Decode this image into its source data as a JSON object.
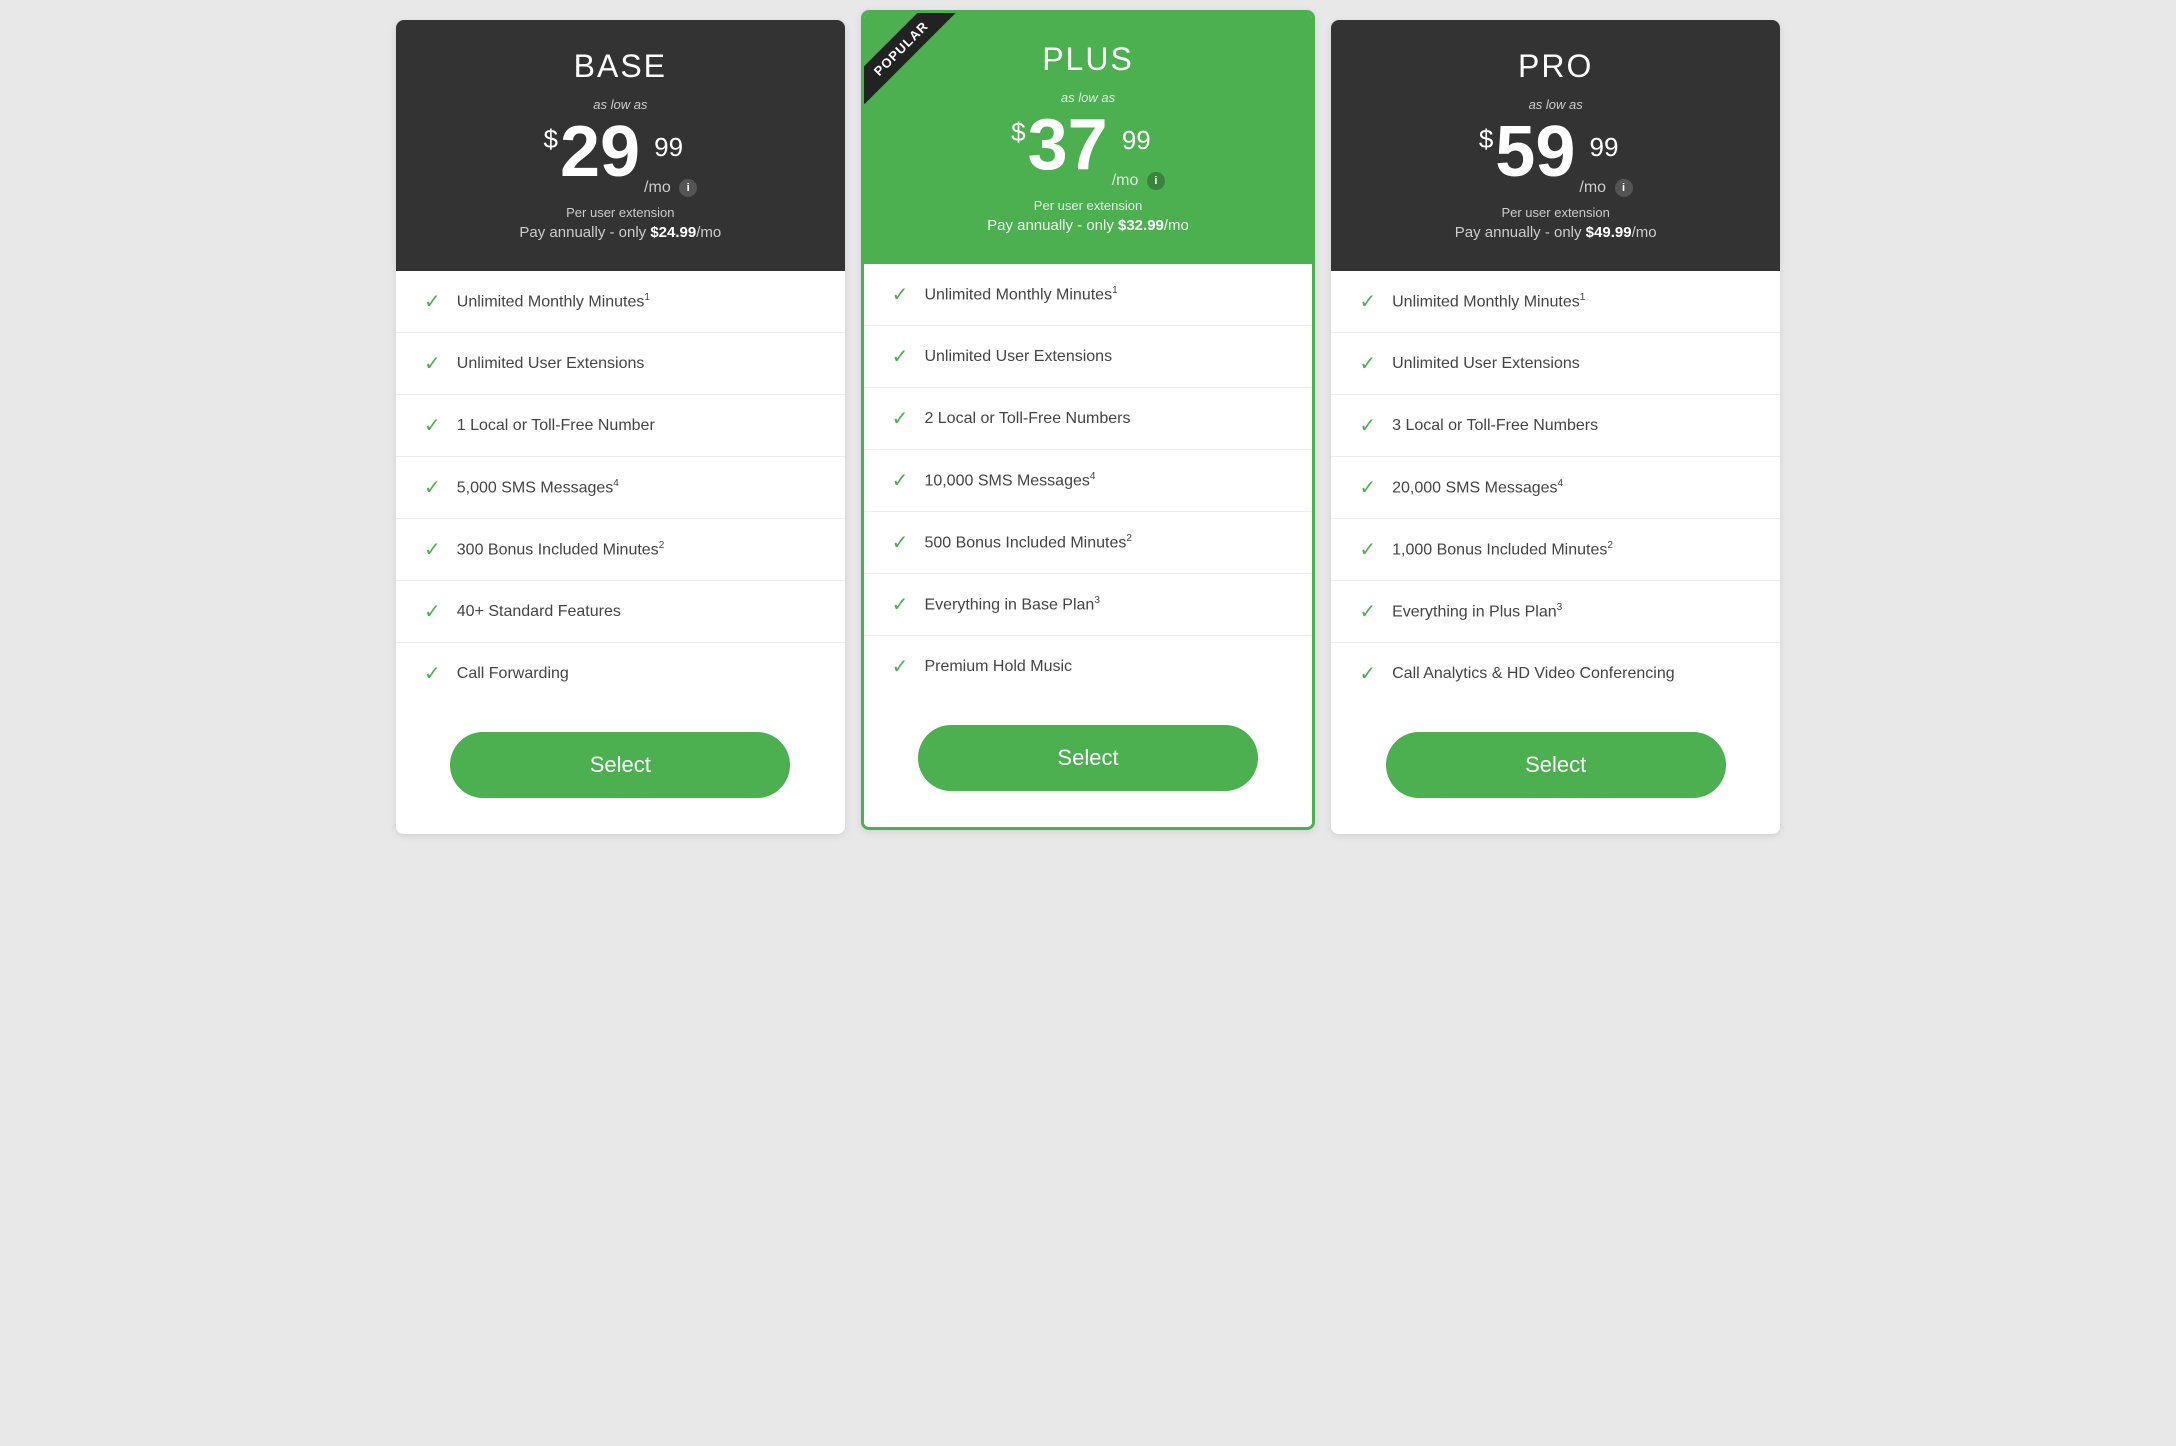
{
  "plans": [
    {
      "id": "base",
      "name": "BASE",
      "popular": false,
      "header_bg": "dark",
      "as_low_as": "as low as",
      "currency": "$",
      "price_main": "29",
      "price_decimal": "99",
      "per_mo": "/mo",
      "per_user": "Per user extension",
      "pay_annually": "Pay annually - only ",
      "annual_price": "$24.99",
      "annual_suffix": "/mo",
      "features": [
        {
          "text": "Unlimited Monthly Minutes",
          "sup": "1"
        },
        {
          "text": "Unlimited User Extensions",
          "sup": ""
        },
        {
          "text": "1 Local or Toll-Free Number",
          "sup": ""
        },
        {
          "text": "5,000 SMS Messages",
          "sup": "4"
        },
        {
          "text": "300 Bonus Included Minutes",
          "sup": "2"
        },
        {
          "text": "40+ Standard Features",
          "sup": ""
        },
        {
          "text": "Call Forwarding",
          "sup": ""
        }
      ],
      "select_label": "Select"
    },
    {
      "id": "plus",
      "name": "PLUS",
      "popular": true,
      "popular_label": "POPULAR",
      "header_bg": "green",
      "as_low_as": "as low as",
      "currency": "$",
      "price_main": "37",
      "price_decimal": "99",
      "per_mo": "/mo",
      "per_user": "Per user extension",
      "pay_annually": "Pay annually - only ",
      "annual_price": "$32.99",
      "annual_suffix": "/mo",
      "features": [
        {
          "text": "Unlimited Monthly Minutes",
          "sup": "1"
        },
        {
          "text": "Unlimited User Extensions",
          "sup": ""
        },
        {
          "text": "2 Local or Toll-Free Numbers",
          "sup": ""
        },
        {
          "text": "10,000 SMS Messages",
          "sup": "4"
        },
        {
          "text": "500 Bonus Included Minutes",
          "sup": "2"
        },
        {
          "text": "Everything in Base Plan",
          "sup": "3"
        },
        {
          "text": "Premium Hold Music",
          "sup": ""
        }
      ],
      "select_label": "Select"
    },
    {
      "id": "pro",
      "name": "PRO",
      "popular": false,
      "header_bg": "dark",
      "as_low_as": "as low as",
      "currency": "$",
      "price_main": "59",
      "price_decimal": "99",
      "per_mo": "/mo",
      "per_user": "Per user extension",
      "pay_annually": "Pay annually - only ",
      "annual_price": "$49.99",
      "annual_suffix": "/mo",
      "features": [
        {
          "text": "Unlimited Monthly Minutes",
          "sup": "1"
        },
        {
          "text": "Unlimited User Extensions",
          "sup": ""
        },
        {
          "text": "3 Local or Toll-Free Numbers",
          "sup": ""
        },
        {
          "text": "20,000 SMS Messages",
          "sup": "4"
        },
        {
          "text": "1,000 Bonus Included Minutes",
          "sup": "2"
        },
        {
          "text": "Everything in Plus Plan",
          "sup": "3"
        },
        {
          "text": "Call Analytics & HD Video Conferencing",
          "sup": ""
        }
      ],
      "select_label": "Select"
    }
  ],
  "colors": {
    "green": "#4caf50",
    "dark": "#333333",
    "check": "#4caf50"
  }
}
